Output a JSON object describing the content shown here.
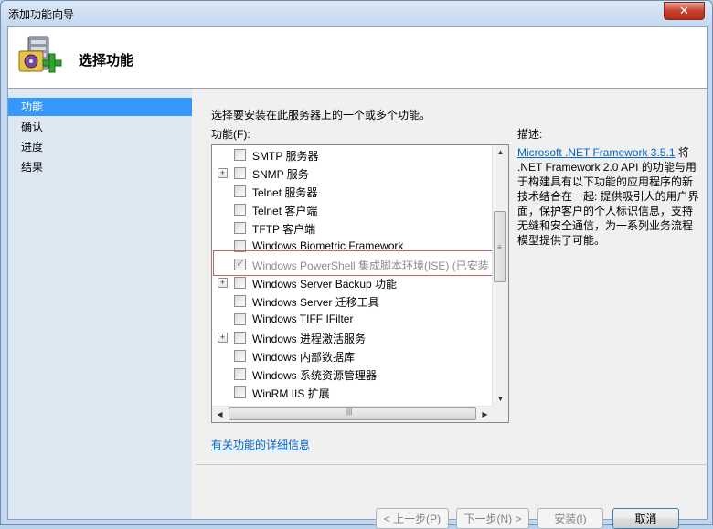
{
  "window": {
    "title": "添加功能向导",
    "close_label": "✕"
  },
  "header": {
    "title": "选择功能",
    "icon": "server-add-icon"
  },
  "nav": {
    "items": [
      {
        "label": "功能",
        "selected": true
      },
      {
        "label": "确认",
        "selected": false
      },
      {
        "label": "进度",
        "selected": false
      },
      {
        "label": "结果",
        "selected": false
      }
    ]
  },
  "main": {
    "instruction": "选择要安装在此服务器上的一个或多个功能。",
    "features_label": "功能(F):",
    "description_label": "描述:",
    "description_link": "Microsoft .NET Framework 3.5.1",
    "description_text": " 将 .NET Framework 2.0 API 的功能与用于构建具有以下功能的应用程序的新技术结合在一起: 提供吸引人的用户界面，保护客户的个人标识信息，支持无缝和安全通信，为一系列业务流程模型提供了可能。",
    "more_info_link": "有关功能的详细信息"
  },
  "features": [
    {
      "label": "SMTP 服务器",
      "expandable": false,
      "checked": false,
      "disabled": false
    },
    {
      "label": "SNMP 服务",
      "expandable": true,
      "checked": false,
      "disabled": false
    },
    {
      "label": "Telnet 服务器",
      "expandable": false,
      "checked": false,
      "disabled": false
    },
    {
      "label": "Telnet 客户端",
      "expandable": false,
      "checked": false,
      "disabled": false
    },
    {
      "label": "TFTP 客户端",
      "expandable": false,
      "checked": false,
      "disabled": false
    },
    {
      "label": "Windows Biometric Framework",
      "expandable": false,
      "checked": false,
      "disabled": false
    },
    {
      "label": "Windows PowerShell 集成脚本环境(ISE) (已安装",
      "expandable": false,
      "checked": true,
      "disabled": true
    },
    {
      "label": "Windows Server Backup 功能",
      "expandable": true,
      "checked": false,
      "disabled": false
    },
    {
      "label": "Windows Server 迁移工具",
      "expandable": false,
      "checked": false,
      "disabled": false
    },
    {
      "label": "Windows TIFF IFilter",
      "expandable": false,
      "checked": false,
      "disabled": false
    },
    {
      "label": "Windows 进程激活服务",
      "expandable": true,
      "checked": false,
      "disabled": false
    },
    {
      "label": "Windows 内部数据库",
      "expandable": false,
      "checked": false,
      "disabled": false
    },
    {
      "label": "Windows 系统资源管理器",
      "expandable": false,
      "checked": false,
      "disabled": false
    },
    {
      "label": "WinRM IIS 扩展",
      "expandable": false,
      "checked": false,
      "disabled": false
    }
  ],
  "buttons": {
    "prev": "< 上一步(P)",
    "next": "下一步(N) >",
    "install": "安装(I)",
    "cancel": "取消"
  }
}
